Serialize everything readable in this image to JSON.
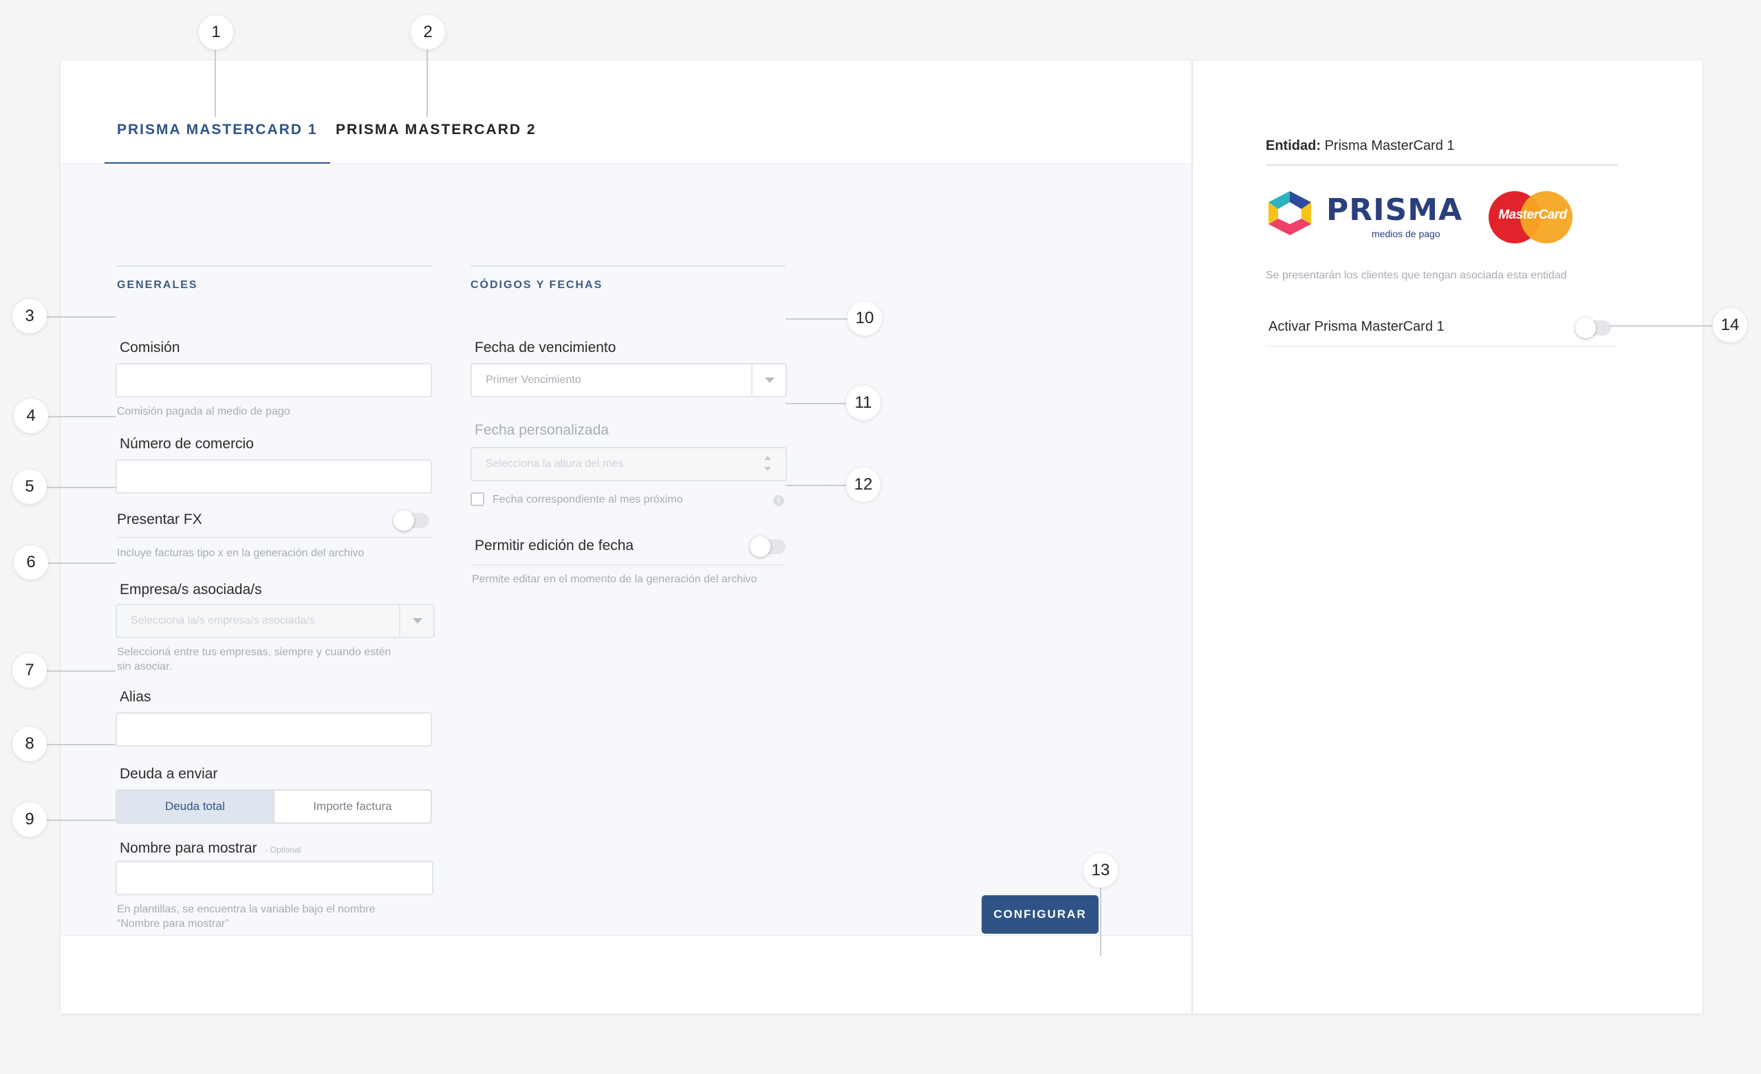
{
  "tabs": [
    {
      "label": "PRISMA MASTERCARD 1",
      "active": true
    },
    {
      "label": "PRISMA MASTERCARD 2",
      "active": false
    }
  ],
  "sections": {
    "generales": "GENERALES",
    "codigos": "CÓDIGOS Y FECHAS"
  },
  "fields": {
    "comision": {
      "label": "Comisión",
      "help": "Comisión pagada al medio de pago",
      "value": ""
    },
    "numero_comercio": {
      "label": "Número de comercio",
      "value": ""
    },
    "presentar_fx": {
      "label": "Presentar FX",
      "help": "Incluye facturas tipo x en la generación del archivo",
      "enabled": false
    },
    "empresas": {
      "label": "Empresa/s asociada/s",
      "placeholder": "Seleccioná la/s empresa/s asociada/s",
      "help_line1": "Seleccioná entre tus empresas, siempre y cuando estén",
      "help_line2": "sin asociar."
    },
    "alias": {
      "label": "Alias",
      "value": ""
    },
    "deuda": {
      "label": "Deuda a enviar",
      "options": [
        "Deuda total",
        "Importe factura"
      ],
      "selected": "Deuda total"
    },
    "nombre_mostrar": {
      "label": "Nombre para mostrar",
      "optional": "- Optional",
      "help_line1": "En plantillas, se encuentra la variable bajo el nombre",
      "help_line2": "“Nombre para mostrar”"
    },
    "fecha_vencimiento": {
      "label": "Fecha de vencimiento",
      "value": "Primer Vencimiento"
    },
    "fecha_personalizada": {
      "label": "Fecha personalizada",
      "placeholder": "Selecciona la altura del mes",
      "checkbox_label": "Fecha correspondiente al mes próximo",
      "info_icon": "i"
    },
    "permitir_edicion": {
      "label": "Permitir edición de fecha",
      "help": "Permite editar en el momento de la generación del archivo",
      "enabled": false
    }
  },
  "footer": {
    "configure_button": "CONFIGURAR"
  },
  "right_panel": {
    "entity_label": "Entidad:",
    "entity_value": "Prisma MasterCard 1",
    "prisma_logo_text": "PRISMA",
    "prisma_logo_sub": "medios de pago",
    "mastercard_logo_text": "MasterCard",
    "description": "Se presentarán los clientes que tengan asociada esta entidad",
    "activate_label": "Activar Prisma MasterCard 1",
    "activate_enabled": false
  },
  "markers": [
    "1",
    "2",
    "3",
    "4",
    "5",
    "6",
    "7",
    "8",
    "9",
    "10",
    "11",
    "12",
    "13",
    "14"
  ],
  "colors": {
    "primary": "#2f5386",
    "background": "#f5f5f5",
    "form_bg": "#f7f8fb"
  }
}
